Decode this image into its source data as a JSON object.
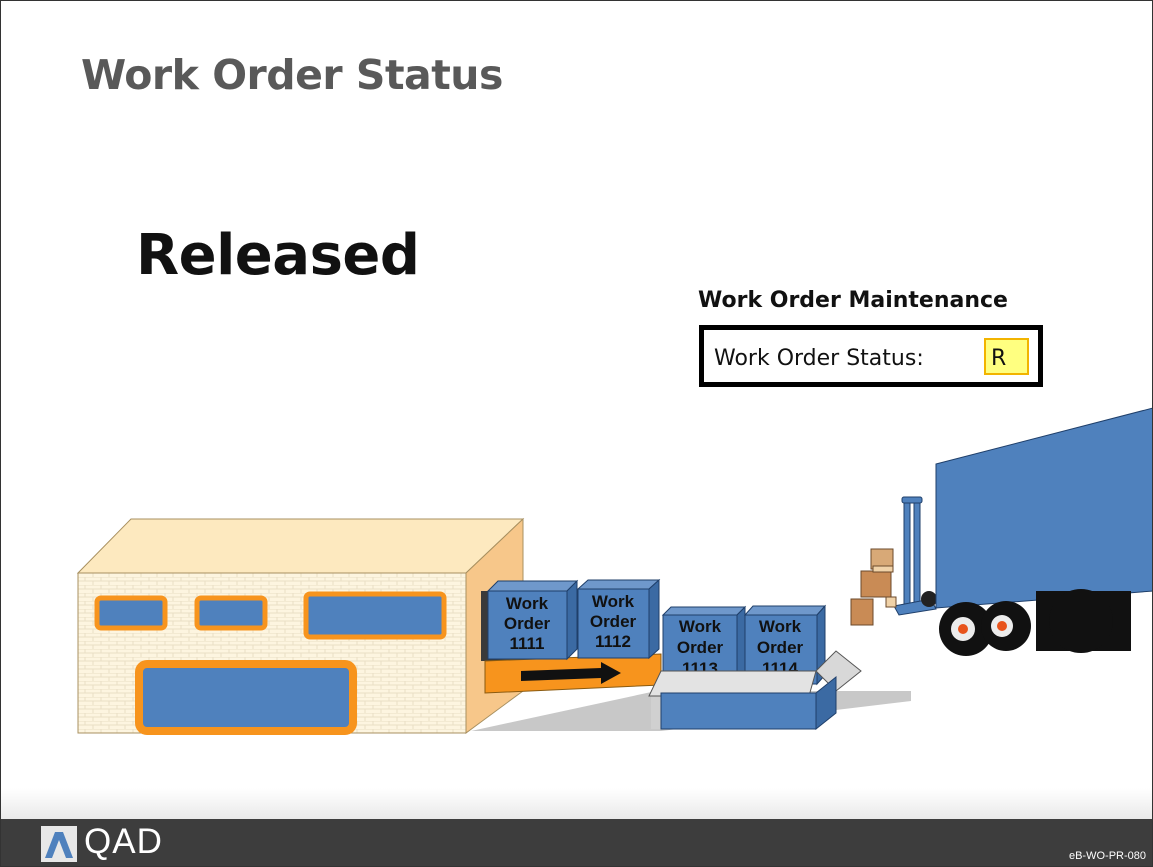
{
  "slide": {
    "title": "Work Order Status",
    "subtitle": "Released"
  },
  "maintenance": {
    "title": "Work Order Maintenance",
    "field_label": "Work Order Status:",
    "field_value": "R"
  },
  "boxes": [
    {
      "line1": "Work",
      "line2": "Order",
      "line3": "1111"
    },
    {
      "line1": "Work",
      "line2": "Order",
      "line3": "1112"
    },
    {
      "line1": "Work",
      "line2": "Order",
      "line3": "1113"
    },
    {
      "line1": "Work",
      "line2": "Order",
      "line3": "1114"
    }
  ],
  "footer": {
    "brand": "QAD",
    "slide_code": "eB-WO-PR-080"
  },
  "colors": {
    "box_blue": "#4f81bd",
    "orange": "#f7941d",
    "title_gray": "#595959"
  }
}
